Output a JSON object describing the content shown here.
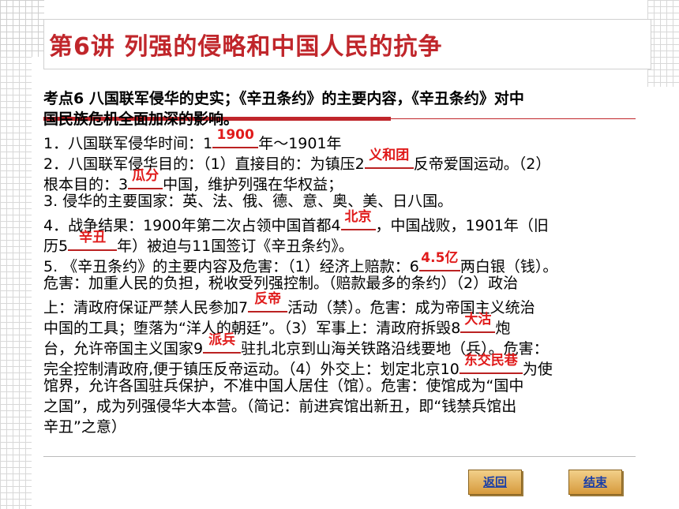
{
  "title": "第6讲 列强的侵略和中国人民的抗争",
  "lines": [
    {
      "pre": "考点6  八国联军侵华的史实；《辛丑条约》的主要内容，《辛丑条约》对中",
      "bold": true
    },
    {
      "pre": "国民族危机全面加深的影响。",
      "bold": true
    },
    {
      "pre": "1．八国联军侵华时间：1",
      "ans": "1900",
      "post": "年～1901年"
    },
    {
      "pre": "2．八国联军侵华目的：（1）直接目的：为镇压2",
      "ans": "义和团",
      "post": "反帝爱国运动。（2）"
    },
    {
      "pre": "根本目的：3",
      "ans": "瓜分",
      "post": "中国，维护列强在华权益；"
    },
    {
      "pre": "3. 侵华的主要国家：英、法、俄、德、意、奥、美、日八国。"
    },
    {
      "pre": "4．战争结果：1900年第二次占领中国首都4",
      "ans": "北京",
      "post": "，中国战败，1901年（旧"
    },
    {
      "pre": "历5",
      "ans": "辛丑",
      "post": "年）被迫与11国签订《辛丑条约》。"
    },
    {
      "pre": "5. 《辛丑条约》的主要内容及危害：（1）经济上赔款：6",
      "ans": "4.5亿",
      "post": "两白银（钱）。"
    },
    {
      "pre": "危害：加重人民的负担，税收受列强控制。（赔款最多的条约）（2）政治"
    },
    {
      "pre": "上：清政府保证严禁人民参加7",
      "ans": "反帝",
      "post": "活动（禁）。危害：成为帝国主义统治"
    },
    {
      "pre": "中国的工具；堕落为“洋人的朝廷”。（3）军事上：清政府拆毁8",
      "ans": "大沽",
      "post": "炮"
    },
    {
      "pre": "台，允许帝国主义国家9",
      "ans": "派兵",
      "post": "驻扎北京到山海关铁路沿线要地（兵）。危害："
    },
    {
      "pre": "完全控制清政府,便于镇压反帝运动。（4）外交上：划定北京10",
      "ans": "东交民巷",
      "post": "为使"
    },
    {
      "pre": "馆界，允许各国驻兵保护，不准中国人居住（馆）。危害：使馆成为“国中"
    },
    {
      "pre": "之国”，成为列强侵华大本营。（简记：前进宾馆出新丑，即“钱禁兵馆出"
    },
    {
      "pre": "辛丑”之意）"
    }
  ],
  "buttons": {
    "back": "返回",
    "end": "结束"
  },
  "colors": {
    "title": "#c0262b",
    "answer": "#e01b1b"
  }
}
